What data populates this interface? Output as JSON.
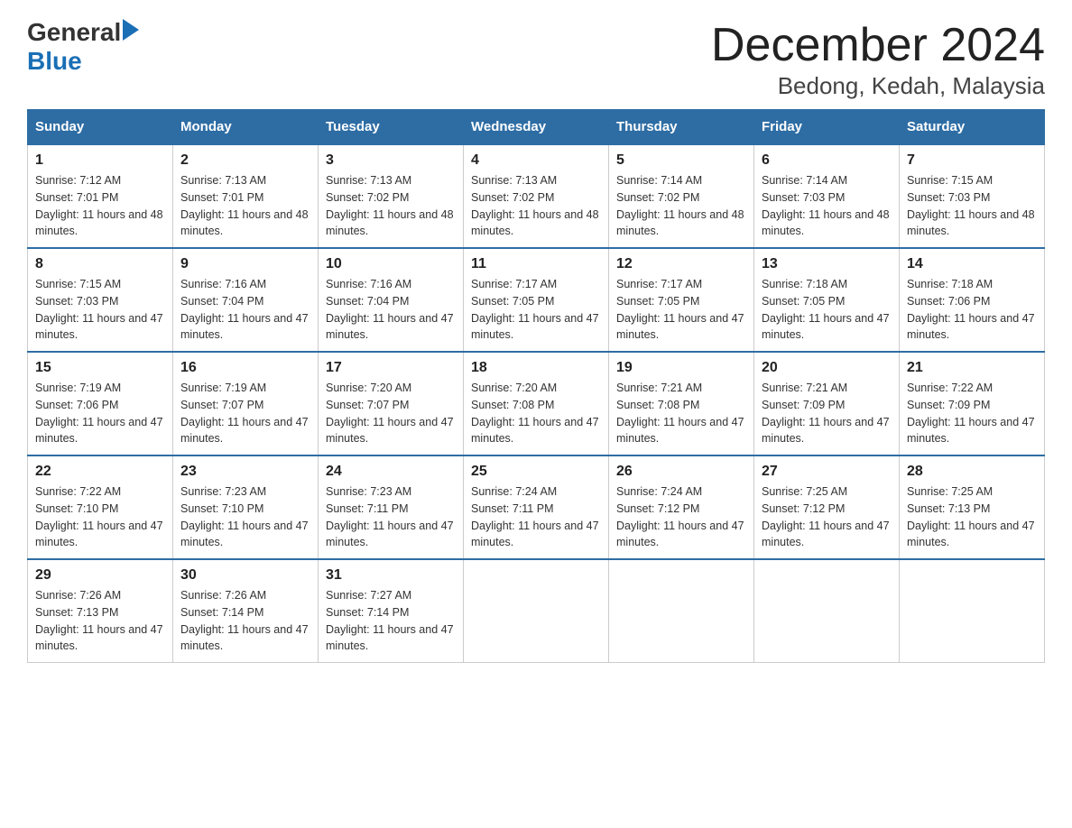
{
  "header": {
    "logo_general": "General",
    "logo_blue": "Blue",
    "title": "December 2024",
    "subtitle": "Bedong, Kedah, Malaysia"
  },
  "days_of_week": [
    "Sunday",
    "Monday",
    "Tuesday",
    "Wednesday",
    "Thursday",
    "Friday",
    "Saturday"
  ],
  "weeks": [
    [
      {
        "day": "1",
        "sunrise": "7:12 AM",
        "sunset": "7:01 PM",
        "daylight": "11 hours and 48 minutes."
      },
      {
        "day": "2",
        "sunrise": "7:13 AM",
        "sunset": "7:01 PM",
        "daylight": "11 hours and 48 minutes."
      },
      {
        "day": "3",
        "sunrise": "7:13 AM",
        "sunset": "7:02 PM",
        "daylight": "11 hours and 48 minutes."
      },
      {
        "day": "4",
        "sunrise": "7:13 AM",
        "sunset": "7:02 PM",
        "daylight": "11 hours and 48 minutes."
      },
      {
        "day": "5",
        "sunrise": "7:14 AM",
        "sunset": "7:02 PM",
        "daylight": "11 hours and 48 minutes."
      },
      {
        "day": "6",
        "sunrise": "7:14 AM",
        "sunset": "7:03 PM",
        "daylight": "11 hours and 48 minutes."
      },
      {
        "day": "7",
        "sunrise": "7:15 AM",
        "sunset": "7:03 PM",
        "daylight": "11 hours and 48 minutes."
      }
    ],
    [
      {
        "day": "8",
        "sunrise": "7:15 AM",
        "sunset": "7:03 PM",
        "daylight": "11 hours and 47 minutes."
      },
      {
        "day": "9",
        "sunrise": "7:16 AM",
        "sunset": "7:04 PM",
        "daylight": "11 hours and 47 minutes."
      },
      {
        "day": "10",
        "sunrise": "7:16 AM",
        "sunset": "7:04 PM",
        "daylight": "11 hours and 47 minutes."
      },
      {
        "day": "11",
        "sunrise": "7:17 AM",
        "sunset": "7:05 PM",
        "daylight": "11 hours and 47 minutes."
      },
      {
        "day": "12",
        "sunrise": "7:17 AM",
        "sunset": "7:05 PM",
        "daylight": "11 hours and 47 minutes."
      },
      {
        "day": "13",
        "sunrise": "7:18 AM",
        "sunset": "7:05 PM",
        "daylight": "11 hours and 47 minutes."
      },
      {
        "day": "14",
        "sunrise": "7:18 AM",
        "sunset": "7:06 PM",
        "daylight": "11 hours and 47 minutes."
      }
    ],
    [
      {
        "day": "15",
        "sunrise": "7:19 AM",
        "sunset": "7:06 PM",
        "daylight": "11 hours and 47 minutes."
      },
      {
        "day": "16",
        "sunrise": "7:19 AM",
        "sunset": "7:07 PM",
        "daylight": "11 hours and 47 minutes."
      },
      {
        "day": "17",
        "sunrise": "7:20 AM",
        "sunset": "7:07 PM",
        "daylight": "11 hours and 47 minutes."
      },
      {
        "day": "18",
        "sunrise": "7:20 AM",
        "sunset": "7:08 PM",
        "daylight": "11 hours and 47 minutes."
      },
      {
        "day": "19",
        "sunrise": "7:21 AM",
        "sunset": "7:08 PM",
        "daylight": "11 hours and 47 minutes."
      },
      {
        "day": "20",
        "sunrise": "7:21 AM",
        "sunset": "7:09 PM",
        "daylight": "11 hours and 47 minutes."
      },
      {
        "day": "21",
        "sunrise": "7:22 AM",
        "sunset": "7:09 PM",
        "daylight": "11 hours and 47 minutes."
      }
    ],
    [
      {
        "day": "22",
        "sunrise": "7:22 AM",
        "sunset": "7:10 PM",
        "daylight": "11 hours and 47 minutes."
      },
      {
        "day": "23",
        "sunrise": "7:23 AM",
        "sunset": "7:10 PM",
        "daylight": "11 hours and 47 minutes."
      },
      {
        "day": "24",
        "sunrise": "7:23 AM",
        "sunset": "7:11 PM",
        "daylight": "11 hours and 47 minutes."
      },
      {
        "day": "25",
        "sunrise": "7:24 AM",
        "sunset": "7:11 PM",
        "daylight": "11 hours and 47 minutes."
      },
      {
        "day": "26",
        "sunrise": "7:24 AM",
        "sunset": "7:12 PM",
        "daylight": "11 hours and 47 minutes."
      },
      {
        "day": "27",
        "sunrise": "7:25 AM",
        "sunset": "7:12 PM",
        "daylight": "11 hours and 47 minutes."
      },
      {
        "day": "28",
        "sunrise": "7:25 AM",
        "sunset": "7:13 PM",
        "daylight": "11 hours and 47 minutes."
      }
    ],
    [
      {
        "day": "29",
        "sunrise": "7:26 AM",
        "sunset": "7:13 PM",
        "daylight": "11 hours and 47 minutes."
      },
      {
        "day": "30",
        "sunrise": "7:26 AM",
        "sunset": "7:14 PM",
        "daylight": "11 hours and 47 minutes."
      },
      {
        "day": "31",
        "sunrise": "7:27 AM",
        "sunset": "7:14 PM",
        "daylight": "11 hours and 47 minutes."
      },
      null,
      null,
      null,
      null
    ]
  ]
}
